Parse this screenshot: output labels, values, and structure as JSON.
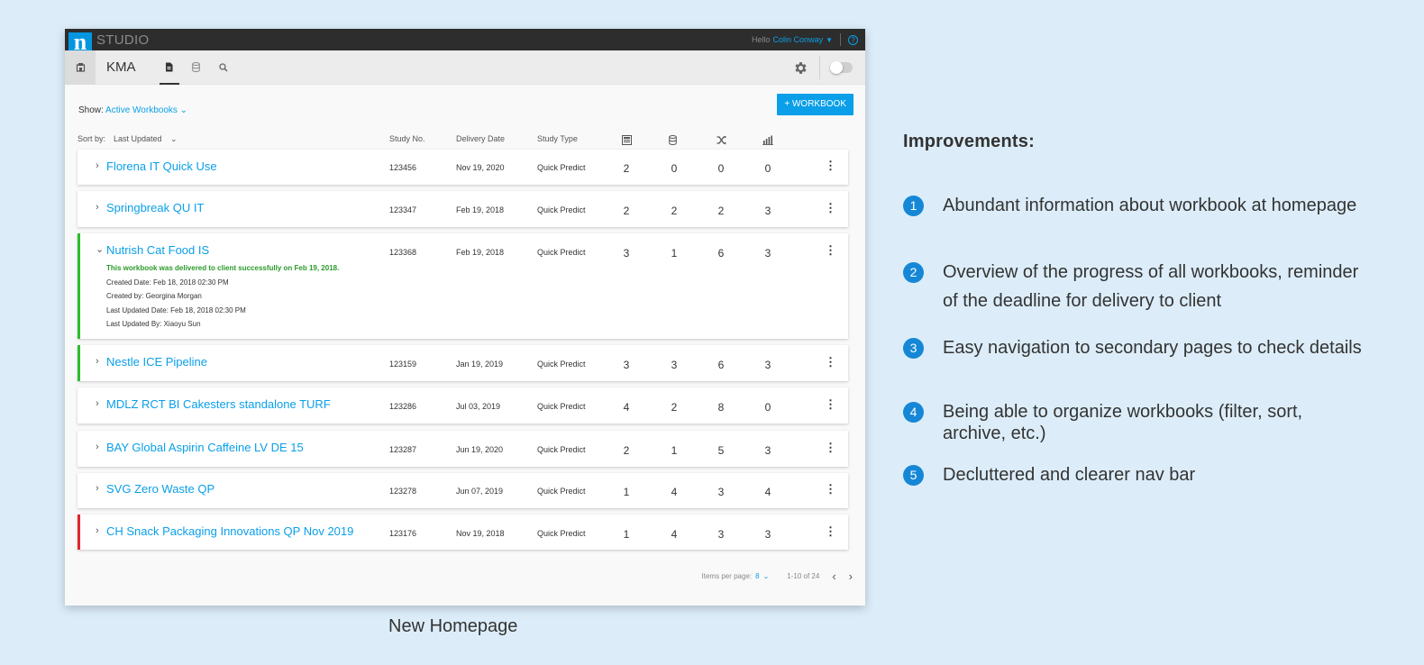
{
  "app": {
    "logo_letter": "n",
    "brand": "STUDIO",
    "greeting": "Hello",
    "user_name": "Colin Conway",
    "help_glyph": "?",
    "project": "KMA",
    "nav_icons": [
      "workbook-icon",
      "database-icon",
      "search-icon"
    ],
    "icons": [
      "home-icon",
      "gear-icon",
      "toggle-switch",
      "help-icon"
    ]
  },
  "filters": {
    "show_label": "Show:",
    "show_value": "Active Workbooks",
    "add_button": "+ WORKBOOK",
    "sort_label": "Sort by:",
    "sort_value": "Last Updated"
  },
  "table": {
    "headers": {
      "study_no": "Study No.",
      "delivery_date": "Delivery Date",
      "study_type": "Study Type"
    },
    "header_icons": [
      "layers-icon",
      "database-icon",
      "shuffle-icon",
      "bar-chart-icon"
    ],
    "rows": [
      {
        "name": "Florena IT Quick Use",
        "study_no": "123456",
        "date": "Nov 19, 2020",
        "type": "Quick Predict",
        "c1": "2",
        "c2": "0",
        "c3": "0",
        "c4": "0"
      },
      {
        "name": "Springbreak QU IT",
        "study_no": "123347",
        "date": "Feb 19, 2018",
        "type": "Quick Predict",
        "c1": "2",
        "c2": "2",
        "c3": "2",
        "c4": "3"
      },
      {
        "name": "Nutrish Cat Food IS",
        "study_no": "123368",
        "date": "Feb 19, 2018",
        "type": "Quick Predict",
        "c1": "3",
        "c2": "1",
        "c3": "6",
        "c4": "3",
        "status": "This workbook was delivered to client successfully on Feb 19, 2018.",
        "created_date": "Created Date: Feb 18, 2018 02:30 PM",
        "created_by": "Created by: Georgina Morgan",
        "last_updated_date": "Last Updated Date: Feb 18, 2018 02:30 PM",
        "last_updated_by": "Last Updated By: Xiaoyu Sun"
      },
      {
        "name": "Nestle ICE Pipeline",
        "study_no": "123159",
        "date": "Jan 19, 2019",
        "type": "Quick Predict",
        "c1": "3",
        "c2": "3",
        "c3": "6",
        "c4": "3"
      },
      {
        "name": "MDLZ RCT BI Cakesters standalone TURF",
        "study_no": "123286",
        "date": "Jul 03, 2019",
        "type": "Quick Predict",
        "c1": "4",
        "c2": "2",
        "c3": "8",
        "c4": "0"
      },
      {
        "name": "BAY Global Aspirin Caffeine LV DE 15",
        "study_no": "123287",
        "date": "Jun 19, 2020",
        "type": "Quick Predict",
        "c1": "2",
        "c2": "1",
        "c3": "5",
        "c4": "3"
      },
      {
        "name": "SVG Zero Waste QP",
        "study_no": "123278",
        "date": "Jun 07, 2019",
        "type": "Quick Predict",
        "c1": "1",
        "c2": "4",
        "c3": "3",
        "c4": "4"
      },
      {
        "name": "CH Snack Packaging Innovations QP Nov 2019",
        "study_no": "123176",
        "date": "Nov 19, 2018",
        "type": "Quick Predict",
        "c1": "1",
        "c2": "4",
        "c3": "3",
        "c4": "3"
      }
    ],
    "row_status_colors": {
      "delivered": "#2ebc2e",
      "overdue": "#e0262b"
    }
  },
  "pagination": {
    "items_label": "Items per page:",
    "items_value": "8",
    "range": "1-10 of 24"
  },
  "caption": "New Homepage",
  "improvements": {
    "title": "Improvements:",
    "items": [
      {
        "num": "1",
        "text": "Abundant information about workbook at homepage"
      },
      {
        "num": "2",
        "text": "Overview of the progress of all workbooks, reminder of the deadline for delivery to client"
      },
      {
        "num": "3",
        "text": "Easy navigation to secondary pages to check details"
      },
      {
        "num": "4",
        "text": "Being able to organize workbooks (filter, sort, archive, etc.)"
      },
      {
        "num": "5",
        "text": "Decluttered and clearer nav bar"
      }
    ]
  },
  "colors": {
    "accent": "#0a9fe8",
    "background": "#dcedf9",
    "topbar": "#2d2d2d",
    "bullet": "#1587d6"
  }
}
